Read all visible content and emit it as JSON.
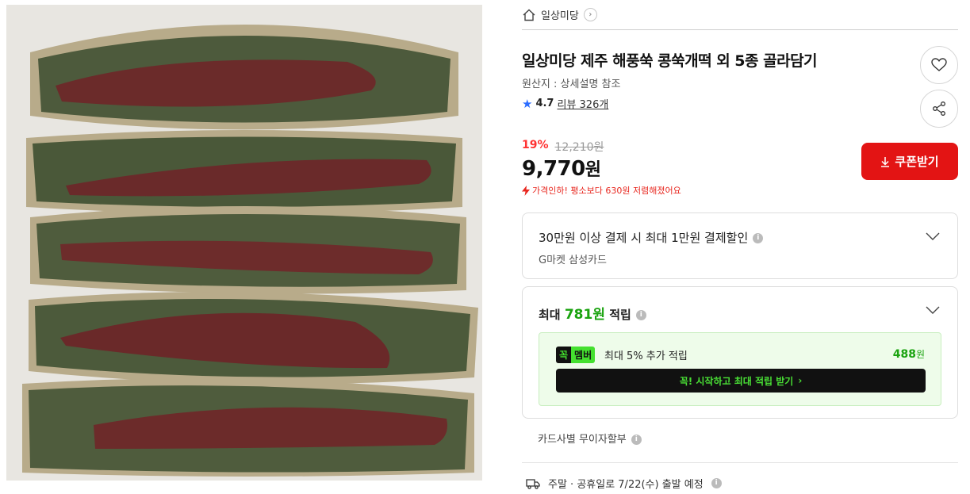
{
  "breadcrumb": {
    "store_name": "일상미당",
    "home_icon": "home-icon",
    "chevron_icon": "chevron-right-icon"
  },
  "product": {
    "title": "일상미당 제주 해풍쑥 콩쑥개떡 외 5종 골라담기",
    "origin": "원산지 : 상세설명 참조",
    "rating": "4.7",
    "review_label": "리뷰 326개",
    "image_alt": "콩쑥개떡 단면 이미지"
  },
  "actions": {
    "wish_icon": "heart-icon",
    "share_icon": "share-icon",
    "coupon_label": "쿠폰받기",
    "coupon_icon": "download-icon"
  },
  "pricing": {
    "discount_rate": "19%",
    "original_price": "12,210원",
    "price": "9,770",
    "price_unit": "원",
    "price_note": "가격인하! 평소보다 630원 저렴해졌어요"
  },
  "card_discount": {
    "title": "30만원 이상 결제 시 최대 1만원 결제할인",
    "subtitle": "G마켓 삼성카드"
  },
  "points": {
    "prefix": "최대 ",
    "amount": "781원",
    "suffix": " 적립",
    "member_badge_k": "꼭",
    "member_badge_m": "멤버",
    "member_text": "최대 5% 추가 적립",
    "member_points": "488",
    "member_points_unit": "원",
    "member_cta": "꼭! 시작하고 최대 적립 받기",
    "member_cta_arrow": "›"
  },
  "installment": {
    "label": "카드사별 무이자할부"
  },
  "delivery": {
    "label": "주말 · 공휴일로 7/22(수) 출발 예정",
    "icon": "truck-icon"
  },
  "colors": {
    "accent_red": "#e31414",
    "points_green": "#1aa30f",
    "member_green": "#44e02f",
    "rating_blue": "#2b6cff"
  }
}
